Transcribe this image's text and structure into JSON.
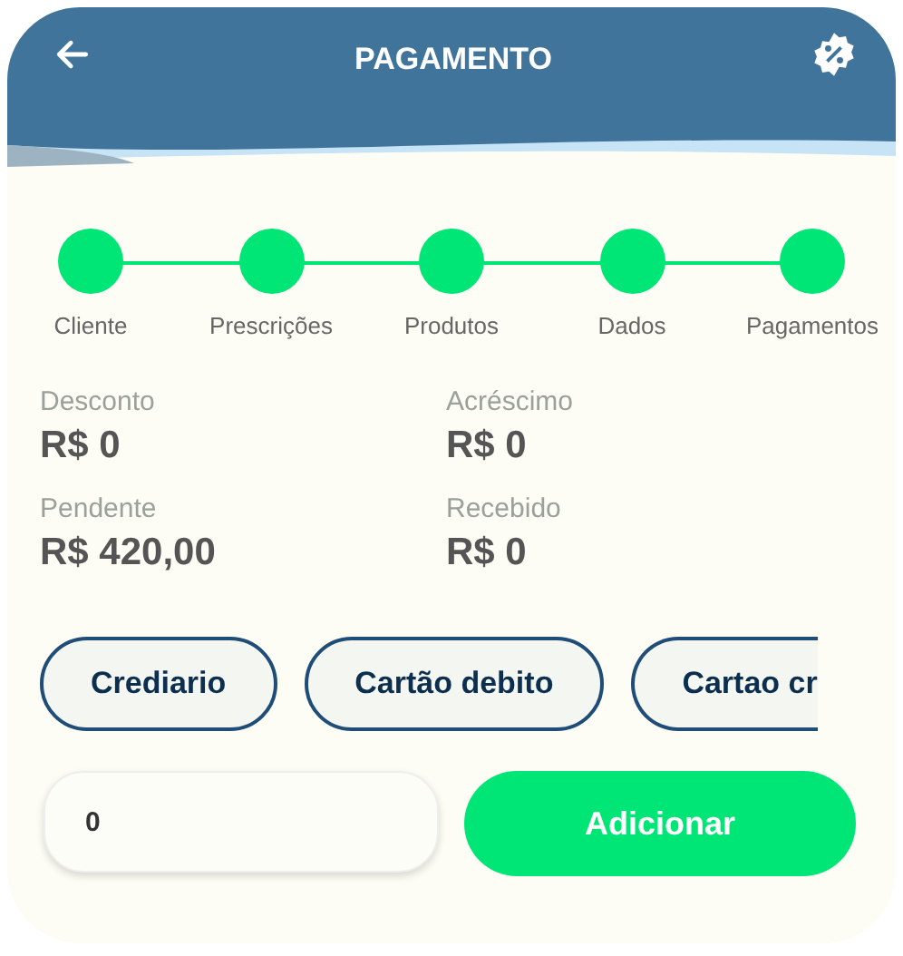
{
  "header": {
    "title": "PAGAMENTO"
  },
  "steps": [
    {
      "label": "Cliente",
      "done": true
    },
    {
      "label": "Prescrições",
      "done": true
    },
    {
      "label": "Produtos",
      "done": true
    },
    {
      "label": "Dados",
      "done": true
    },
    {
      "label": "Pagamentos",
      "done": true
    }
  ],
  "summary": [
    {
      "label": "Desconto",
      "value": "R$ 0"
    },
    {
      "label": "Acréscimo",
      "value": "R$ 0"
    },
    {
      "label": "Pendente",
      "value": "R$ 420,00"
    },
    {
      "label": "Recebido",
      "value": "R$ 0"
    }
  ],
  "payment_methods": [
    {
      "label": "Crediario",
      "kind": "full"
    },
    {
      "label": "Cartão debito",
      "kind": "full"
    },
    {
      "label": "Cartao cr",
      "kind": "cut"
    }
  ],
  "amount": {
    "value": "0"
  },
  "add_button": {
    "label": "Adicionar"
  }
}
